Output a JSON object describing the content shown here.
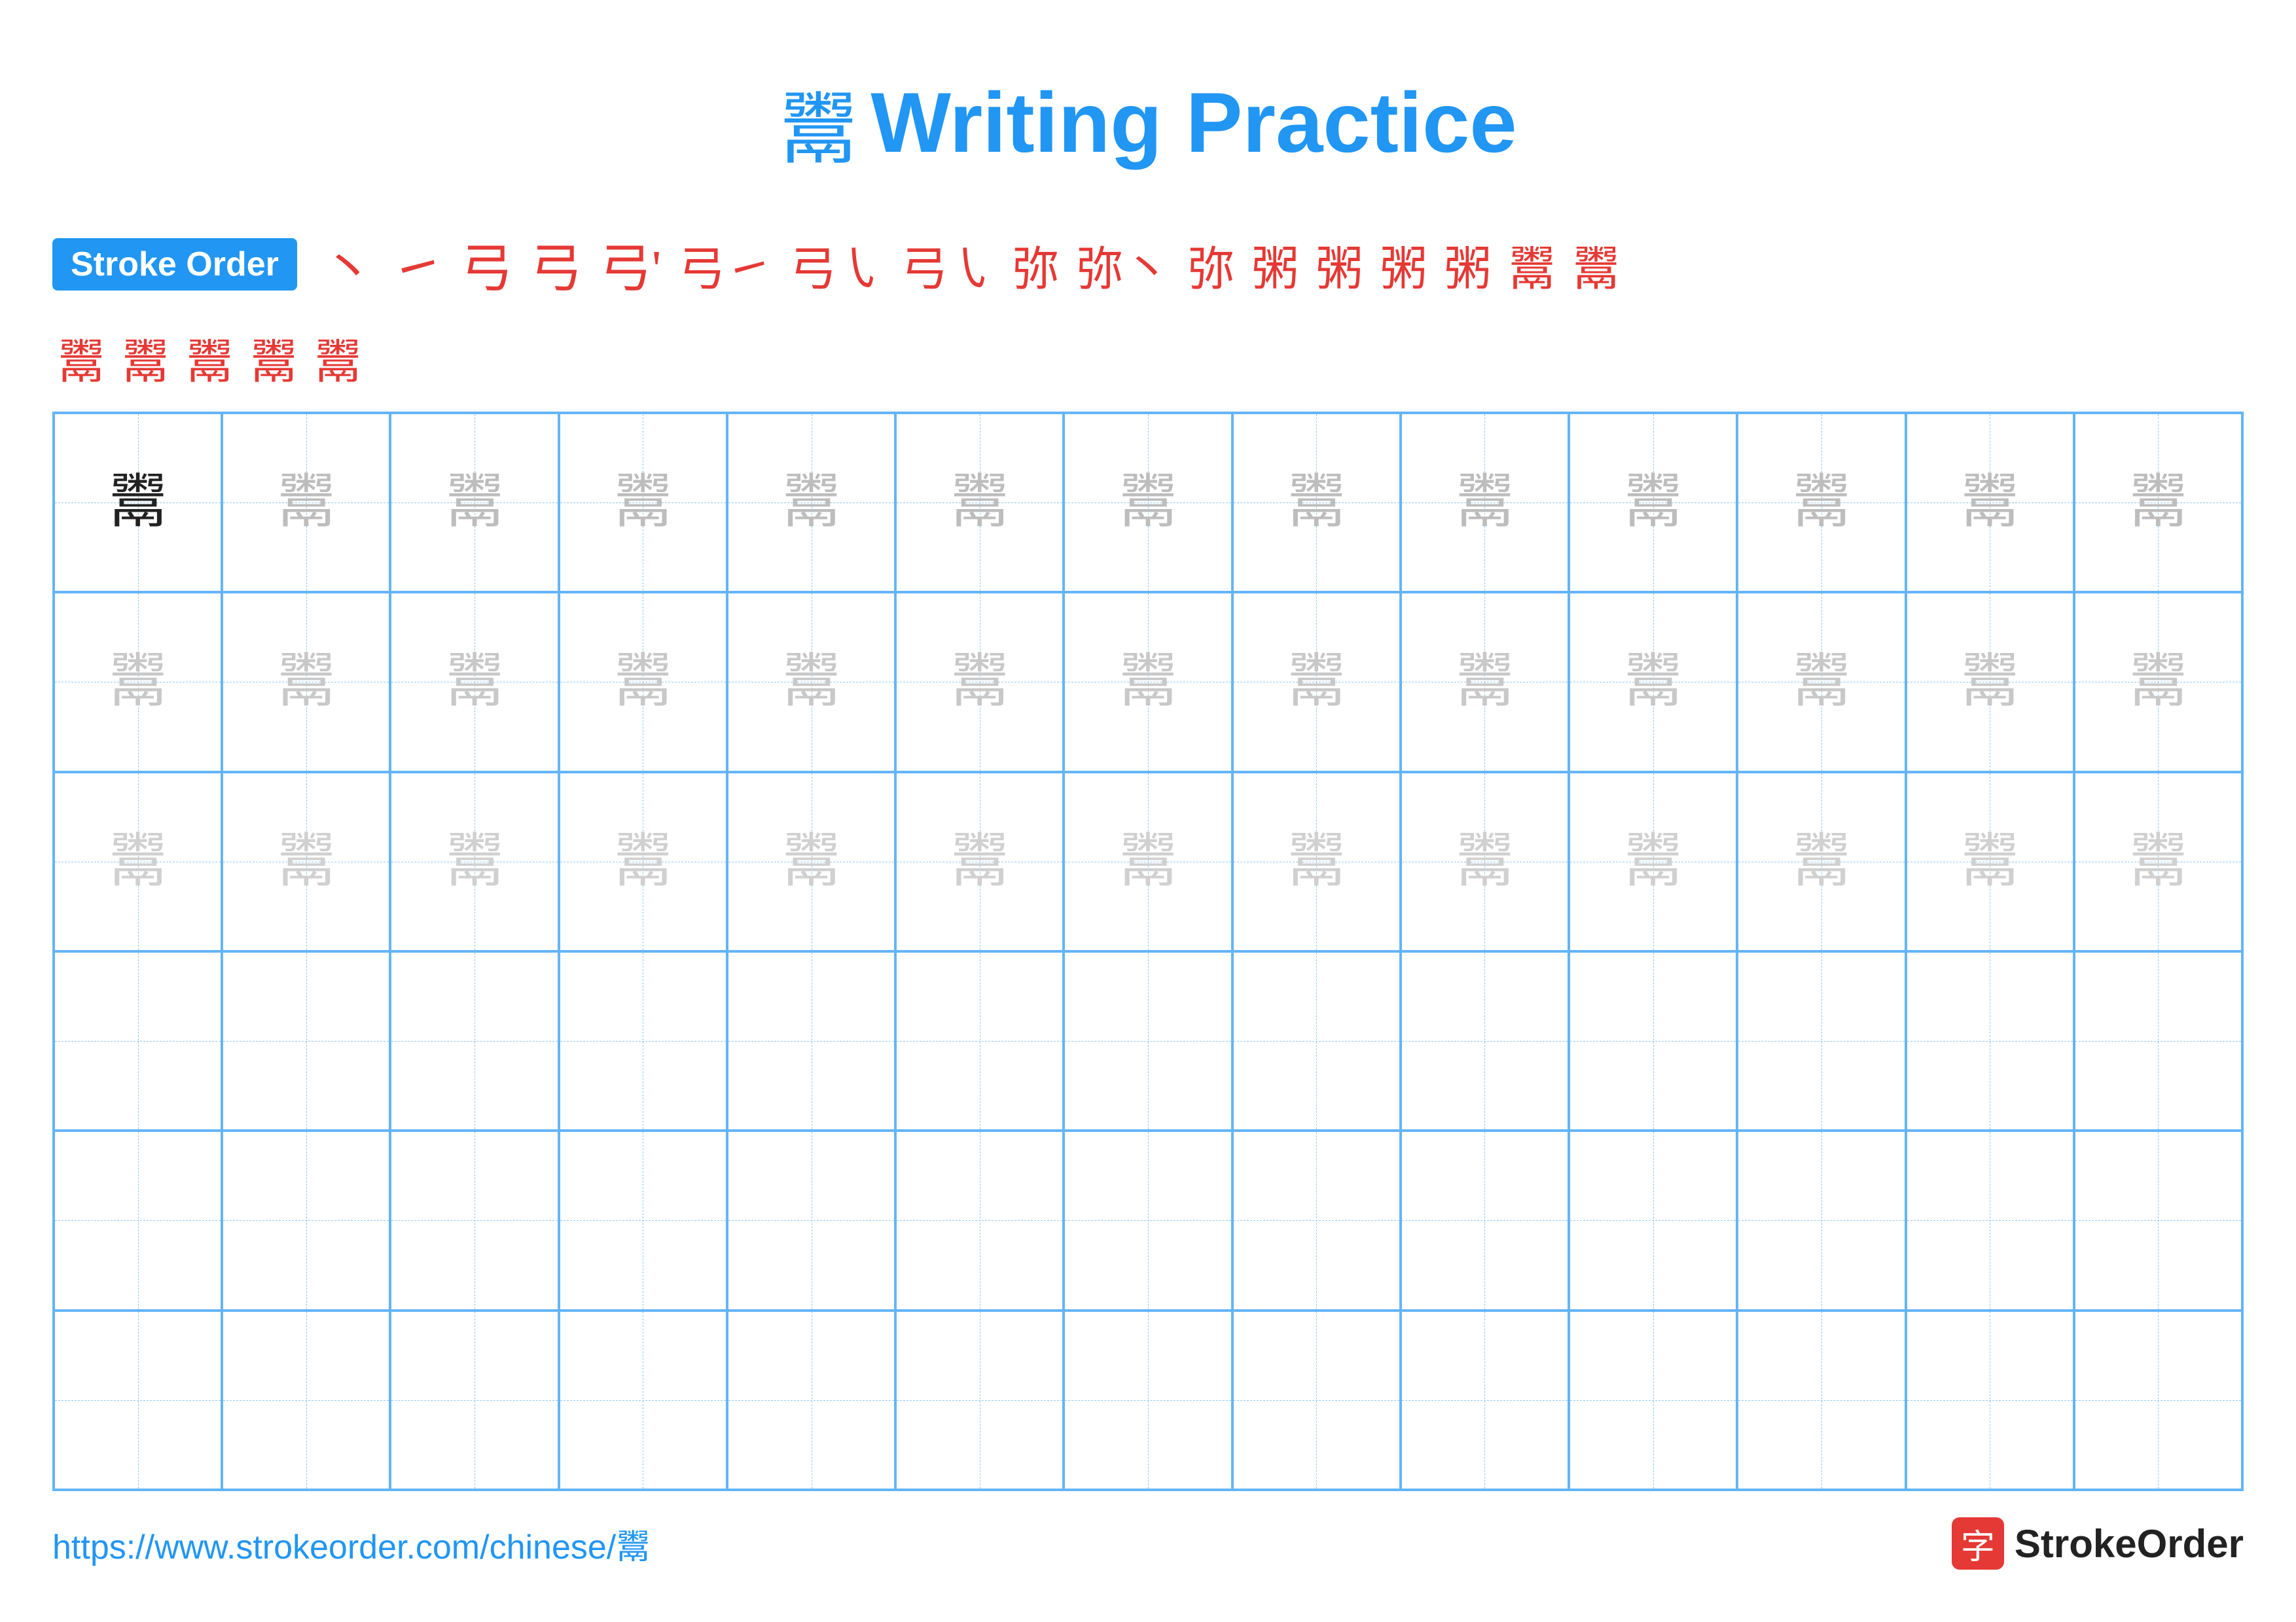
{
  "title": {
    "char": "鬻",
    "text": "Writing Practice"
  },
  "stroke_order": {
    "badge_label": "Stroke Order",
    "strokes_row1": [
      "丶",
      "㇀",
      "弓",
      "弓",
      "弓'",
      "弓㇀",
      "弓㇂",
      "弓㇂",
      "弥",
      "弥丶",
      "弥㇀",
      "粥",
      "粥",
      "粥",
      "粥",
      "鬻",
      "鬻"
    ],
    "strokes_row2": [
      "鬻",
      "鬻",
      "鬻",
      "鬻",
      "鬻"
    ]
  },
  "practice": {
    "char": "鬻",
    "grid_cols": 13,
    "grid_rows": 6,
    "dark_cells": 1,
    "light_rows": 3
  },
  "footer": {
    "url": "https://www.strokeorder.com/chinese/鬻",
    "brand_char": "字",
    "brand_name": "StrokeOrder"
  }
}
